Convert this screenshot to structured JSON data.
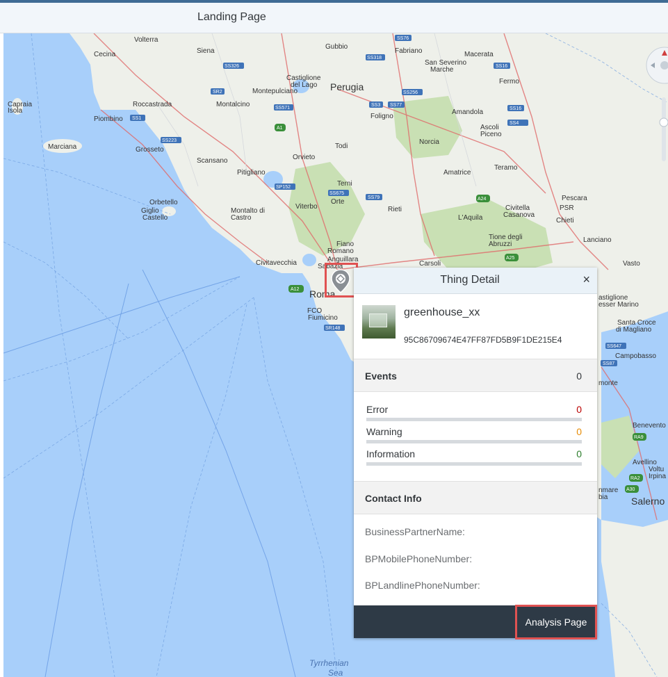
{
  "header": {
    "title": "Landing Page"
  },
  "map": {
    "labels": {
      "volterra": "Volterra",
      "siena": "Siena",
      "gubbio": "Gubbio",
      "fabriano": "Fabriano",
      "macerata": "Macerata",
      "cecina": "Cecina",
      "san_severino": "San Severino",
      "marche": "Marche",
      "castiglione": "Castiglione",
      "del_lago": "del Lago",
      "montepulciano": "Montepulciano",
      "perugia": "Perugia",
      "fermo": "Fermo",
      "capraia": "Capraia",
      "isola": "Isola",
      "roccastrada": "Roccastrada",
      "montalcino": "Montalcino",
      "foligno": "Foligno",
      "amandola": "Amandola",
      "piombino": "Piombino",
      "ascoli": "Ascoli",
      "piceno": "Piceno",
      "norcia": "Norcia",
      "grosseto": "Grosseto",
      "marciana": "Marciana",
      "todi": "Todi",
      "scansano": "Scansano",
      "orvieto": "Orvieto",
      "teramo": "Teramo",
      "pitigliano": "Pitigliano",
      "amatrice": "Amatrice",
      "terni": "Terni",
      "orte": "Orte",
      "pescara": "Pescara",
      "orbetello": "Orbetello",
      "giglio": "Giglio",
      "castello": "Castello",
      "montalto": "Montalto di",
      "castro": "Castro",
      "viterbo": "Viterbo",
      "rieti": "Rieti",
      "civitella": "Civitella",
      "casanova": "Casanova",
      "psr": "PSR",
      "chieti": "Chieti",
      "laquila": "L'Aquila",
      "fiano": "Fiano",
      "romano": "Romano",
      "tione": "Tione degli",
      "abruzzi": "Abruzzi",
      "lanciano": "Lanciano",
      "civitavecchia": "Civitavecchia",
      "anguillara": "Anguillara",
      "sabazia": "Sabazia",
      "carsoli": "Carsoli",
      "vasto": "Vasto",
      "roma": "Roma",
      "fco": "FCO",
      "fiumicino": "Fiumicino",
      "castiglione2": "astiglione",
      "messer_marino": "esser Marino",
      "santa_croce": "Santa Croce",
      "di_magliano": "di Magliano",
      "campobasso": "Campobasso",
      "monte": "monte",
      "benevento": "Benevento",
      "avellino": "Avellino",
      "volturara": "Voltu",
      "irpina": "Irpina",
      "salerno": "Salerno",
      "nmare": "nmare",
      "bia": "bia",
      "tyrrhenian": "Tyrrhenian",
      "sea": "Sea"
    },
    "roads": {
      "ss76": "SS76",
      "ss318": "SS318",
      "ss326": "SS326",
      "ss16": "SS16",
      "sr2": "SR2",
      "ss3": "SS3",
      "ss77": "SS77",
      "ss256": "SS256",
      "ss571": "SS571",
      "ss4": "SS4",
      "ss223": "SS223",
      "ss1": "SS1",
      "a1": "A1",
      "sp152": "SP152",
      "ss675": "SS675",
      "ss79": "SS79",
      "a24": "A24",
      "a25": "A25",
      "a12": "A12",
      "sr148": "SR148",
      "ra9": "RA9",
      "ra2": "RA2",
      "a30": "A30",
      "ss647": "SS647",
      "ss87": "SS87"
    }
  },
  "panel": {
    "title": "Thing Detail",
    "close_glyph": "×",
    "thing_name": "greenhouse_xx",
    "thing_id": "95C86709674E47FF87FD5B9F1DE215E4",
    "events": {
      "label": "Events",
      "count": "0",
      "rows": [
        {
          "name": "Error",
          "value": "0",
          "color": "#bb0000"
        },
        {
          "name": "Warning",
          "value": "0",
          "color": "#e78c07"
        },
        {
          "name": "Information",
          "value": "0",
          "color": "#2b7d2b"
        }
      ]
    },
    "contact": {
      "label": "Contact Info",
      "fields": [
        "BusinessPartnerName:",
        "BPMobilePhoneNumber:",
        "BPLandlinePhoneNumber:"
      ]
    },
    "analysis_button": "Analysis Page"
  }
}
